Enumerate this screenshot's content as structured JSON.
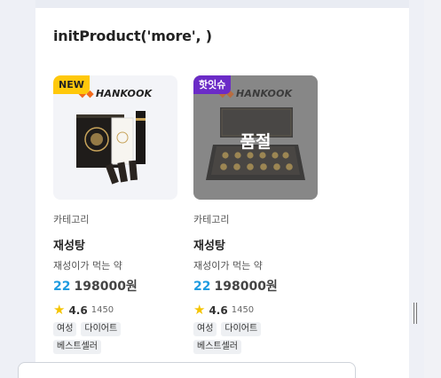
{
  "section": {
    "title": "initProduct('more', )"
  },
  "products": [
    {
      "badge": "NEW",
      "brand": "HANKOOK",
      "sold_out": false,
      "category": "카테고리",
      "name": "재성탕",
      "description": "재성이가 먹는 약",
      "discount": "22",
      "price": "198000원",
      "rating": "4.6",
      "reviews": "1450",
      "tags": [
        "여성",
        "다이어트",
        "베스트셀러"
      ]
    },
    {
      "badge": "핫잇슈",
      "brand": "HANKOOK",
      "sold_out": true,
      "sold_out_label": "품절",
      "category": "카테고리",
      "name": "재성탕",
      "description": "재성이가 먹는 약",
      "discount": "22",
      "price": "198000원",
      "rating": "4.6",
      "reviews": "1450",
      "tags": [
        "여성",
        "다이어트",
        "베스트셀러"
      ]
    }
  ],
  "icons": {
    "rating": "star-icon",
    "brand": "hankook-logo-icon",
    "handle": "resize-handle-icon"
  },
  "colors": {
    "discount": "#1e9be0",
    "badge_new": "#ffc80b",
    "badge_hot": "#6b2bc7",
    "star": "#f5c400"
  }
}
